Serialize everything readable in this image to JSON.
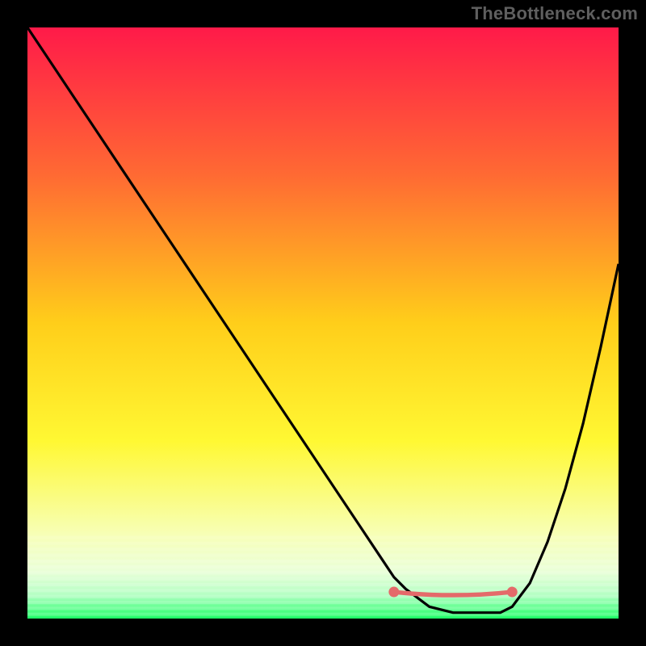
{
  "watermark": "TheBottleneck.com",
  "chart_data": {
    "type": "line",
    "title": "",
    "xlabel": "",
    "ylabel": "",
    "xlim": [
      0,
      100
    ],
    "ylim": [
      0,
      100
    ],
    "grid": false,
    "legend": "none",
    "annotations": [],
    "gradient_stops": [
      {
        "offset": 0,
        "color": "#ff1a49"
      },
      {
        "offset": 0.25,
        "color": "#ff6a33"
      },
      {
        "offset": 0.5,
        "color": "#ffce1a"
      },
      {
        "offset": 0.7,
        "color": "#fff833"
      },
      {
        "offset": 0.86,
        "color": "#f7ffb8"
      },
      {
        "offset": 0.92,
        "color": "#eaffd8"
      },
      {
        "offset": 0.96,
        "color": "#b4ffc3"
      },
      {
        "offset": 1.0,
        "color": "#1dff66"
      }
    ],
    "stripe_count": 14,
    "series": [
      {
        "name": "curve",
        "color": "#000000",
        "x": [
          0,
          4,
          8,
          12,
          16,
          20,
          24,
          28,
          32,
          36,
          40,
          44,
          48,
          52,
          56,
          60,
          62,
          64,
          68,
          72,
          76,
          80,
          82,
          85,
          88,
          91,
          94,
          97,
          100
        ],
        "y": [
          100,
          94,
          88,
          82,
          76,
          70,
          64,
          58,
          52,
          46,
          40,
          34,
          28,
          22,
          16,
          10,
          7,
          5,
          2,
          1,
          1,
          1,
          2,
          6,
          13,
          22,
          33,
          46,
          60
        ]
      }
    ],
    "caps": {
      "left": {
        "x": 62,
        "y": 4.5
      },
      "right": {
        "x": 82,
        "y": 4.5
      },
      "color": "#e46a6a",
      "connector_color": "#e46a6a"
    }
  }
}
